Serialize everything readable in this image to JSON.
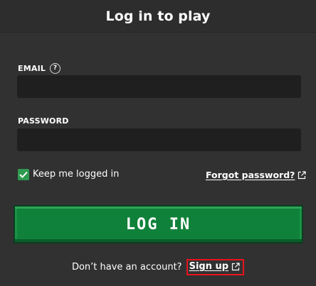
{
  "header": {
    "title": "Log in to play"
  },
  "email": {
    "label": "EMAIL",
    "help_icon": "?",
    "value": "",
    "placeholder": ""
  },
  "password": {
    "label": "PASSWORD",
    "value": "",
    "placeholder": ""
  },
  "remember": {
    "label": "Keep me logged in",
    "checked": true
  },
  "forgot": {
    "label": "Forgot password?"
  },
  "login_button": {
    "label": "LOG IN"
  },
  "signup": {
    "prompt": "Don’t have an account?",
    "link_label": "Sign up"
  },
  "colors": {
    "background": "#313131",
    "input_background": "#1f1f1f",
    "accent_green": "#10813a",
    "highlight_red": "#e8141d"
  },
  "icons": {
    "help": "question-circle-icon",
    "checkbox": "check-icon",
    "external_link": "external-link-icon"
  }
}
